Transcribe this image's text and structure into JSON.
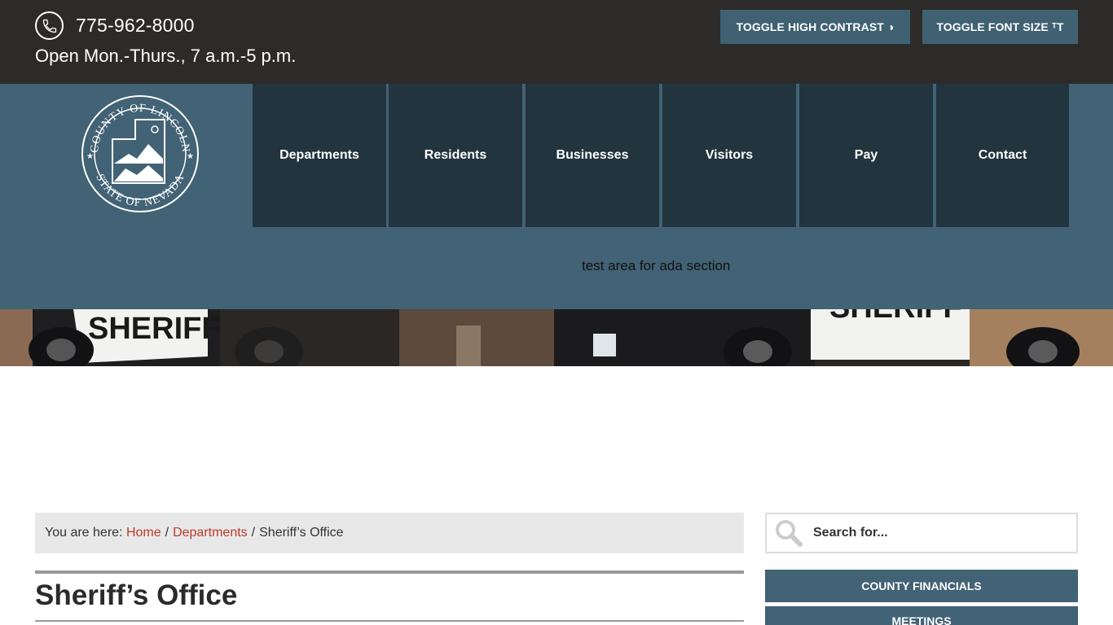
{
  "topbar": {
    "phone": "775-962-8000",
    "hours": "Open Mon.-Thurs., 7 a.m.-5 p.m.",
    "toggle_contrast_label": "TOGGLE HIGH CONTRAST",
    "toggle_font_label": "TOGGLE FONT SIZE",
    "contrast_glyph": "◑",
    "font_glyph": "ᵀT"
  },
  "logo": {
    "top_text": "COUNTY OF LINCOLN",
    "bottom_text": "STATE OF NEVADA"
  },
  "nav": {
    "items": [
      {
        "label": "Departments"
      },
      {
        "label": "Residents"
      },
      {
        "label": "Businesses"
      },
      {
        "label": "Visitors"
      },
      {
        "label": "Pay"
      },
      {
        "label": "Contact"
      }
    ]
  },
  "header": {
    "ada_text": "test area for ada section"
  },
  "banner": {
    "text_left": "SHERIFF",
    "text_right": "SHERIFF"
  },
  "breadcrumb": {
    "prefix": "You are here:",
    "home": "Home",
    "departments": "Departments",
    "current": "Sheriff’s Office",
    "separator": "/"
  },
  "page": {
    "title": "Sheriff’s Office"
  },
  "sidebar": {
    "search_placeholder": "Search for...",
    "buttons": [
      {
        "label": "COUNTY FINANCIALS"
      },
      {
        "label": "MEETINGS"
      }
    ]
  },
  "colors": {
    "topbar_bg": "#2d2b29",
    "header_bg": "#426275",
    "nav_bg": "#22343d",
    "link": "#c0392b"
  }
}
